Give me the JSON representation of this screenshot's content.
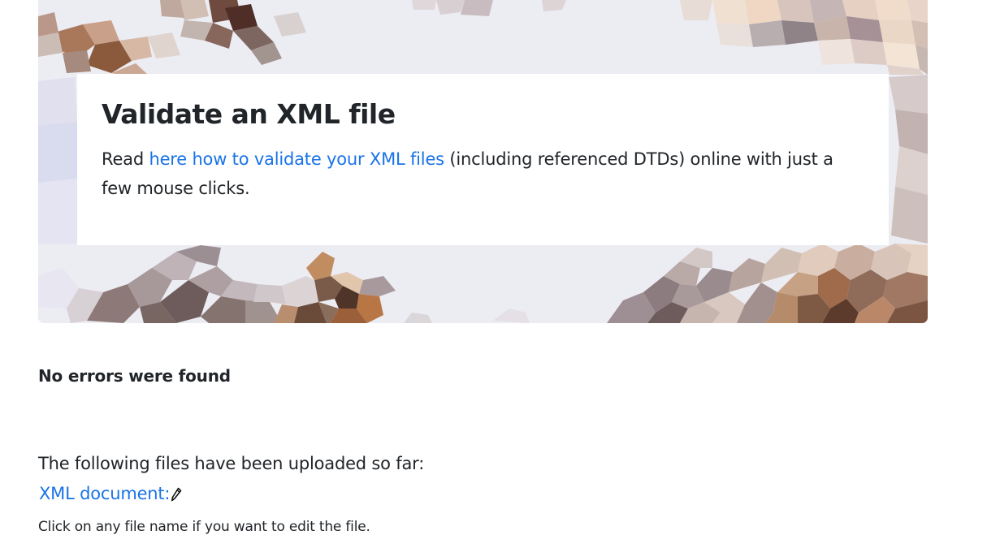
{
  "hero": {
    "title": "Validate an XML file",
    "intro_before": "Read ",
    "intro_link": "here how to validate your XML files",
    "intro_after": " (including referenced DTDs) online with just a few mouse clicks."
  },
  "result": {
    "status": "No errors were found"
  },
  "files": {
    "heading": "The following files have been uploaded so far:",
    "items": [
      {
        "label": "XML document:",
        "icon": "pencil-icon"
      }
    ],
    "hint": "Click on any file name if you want to edit the file."
  },
  "colors": {
    "link": "#1a73e8",
    "text": "#212529",
    "hero_bg": "#ececf3"
  }
}
